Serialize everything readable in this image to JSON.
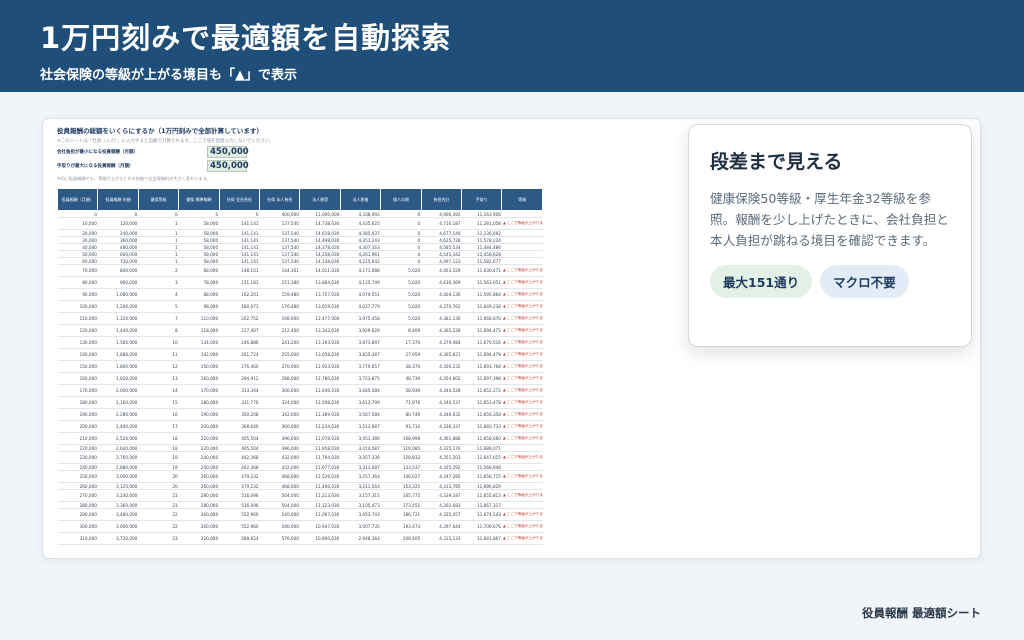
{
  "header": {
    "title": "1万円刻みで最適額を自動探索",
    "subtitle": "社会保険の等級が上がる境目も「▲」で表示"
  },
  "sheet": {
    "title": "役員報酬の総額をいくらにするか（1万円刻みで全部計算しています）",
    "note": "※このシートは「社員（入力）」に入力すると自動で計算されます。ここで値を直接入力しないでください。",
    "max_label": "会社負担が最小になる役員報酬（月額）",
    "max_value": "450,000",
    "takehome_label": "手取りが最大になる役員報酬（月額）",
    "takehome_value": "450,000",
    "note2": "※同じ役員報酬でも、等級が上がるとその前後で社会保険料が大きく変わります。",
    "columns": [
      "役員報酬（月額）",
      "役員報酬 年額",
      "健保等級",
      "健保 標準報酬",
      "社保 会社負担",
      "社保 本人負担",
      "法人税等",
      "法人税後",
      "個人の税",
      "負担合計",
      "手取り",
      "等級"
    ],
    "rows": [
      [
        "0",
        "0",
        "0",
        "0",
        "0",
        "400,000",
        "11,000,000",
        "4,338,092",
        "0",
        "4,906,392",
        "11,163,906",
        ""
      ],
      [
        "10,000",
        "120,000",
        "1",
        "58,000",
        "141,141",
        "137,540",
        "14,738,030",
        "4,435,625",
        "0",
        "4,716,187",
        "11,281,058",
        "▲ ここで等級が上がります"
      ],
      [
        "20,000",
        "240,000",
        "1",
        "58,000",
        "141,141",
        "137,540",
        "14,618,030",
        "4,385,437",
        "0",
        "4,677,149",
        "11,236,692",
        ""
      ],
      [
        "30,000",
        "360,000",
        "1",
        "58,000",
        "141,141",
        "137,540",
        "14,498,030",
        "4,351,243",
        "0",
        "4,625,728",
        "11,578,224",
        ""
      ],
      [
        "40,000",
        "480,000",
        "1",
        "58,000",
        "141,141",
        "137,540",
        "14,378,030",
        "4,307,163",
        "0",
        "4,585,534",
        "11,484,486",
        ""
      ],
      [
        "50,000",
        "600,000",
        "1",
        "58,000",
        "141,141",
        "137,540",
        "14,258,030",
        "4,261,961",
        "0",
        "4,545,342",
        "11,458,628",
        ""
      ],
      [
        "60,000",
        "720,000",
        "1",
        "58,000",
        "141,141",
        "137,540",
        "14,138,030",
        "4,215,642",
        "0",
        "4,497,123",
        "11,582,677",
        ""
      ],
      [
        "70,000",
        "840,000",
        "2",
        "68,000",
        "148,101",
        "144,361",
        "14,011,030",
        "4,171,088",
        "5,020",
        "4,463,529",
        "11,630,471",
        "▲ ここで等級が上がります"
      ],
      [
        "80,000",
        "960,000",
        "3",
        "78,000",
        "151,181",
        "151,380",
        "13,884,030",
        "4,125,749",
        "5,020",
        "4,430,369",
        "11,563,051",
        "▲ ここで等級が上がります"
      ],
      [
        "90,000",
        "1,080,000",
        "4",
        "88,000",
        "162,201",
        "159,480",
        "13,757,030",
        "4,079,551",
        "5,020",
        "4,404,136",
        "11,595,864",
        "▲ ここで等級が上がります"
      ],
      [
        "100,000",
        "1,200,000",
        "5",
        "98,000",
        "180,073",
        "176,480",
        "13,619,030",
        "4,027,779",
        "5,020",
        "4,370,762",
        "11,649,238",
        "▲ ここで等級が上がります"
      ],
      [
        "110,000",
        "1,320,000",
        "7",
        "110,000",
        "202,752",
        "198,000",
        "12,477,000",
        "3,975,458",
        "5,020",
        "4,381,130",
        "11,668,870",
        "▲ ここで等級が上がります"
      ],
      [
        "120,000",
        "1,440,000",
        "8",
        "118,000",
        "217,407",
        "212,400",
        "13,342,030",
        "3,929,628",
        "6,409",
        "4,365,528",
        "11,694,475",
        "▲ ここで等級が上がります"
      ],
      [
        "130,000",
        "1,560,000",
        "10",
        "134,000",
        "246,886",
        "241,200",
        "13,193,030",
        "3,873,897",
        "17,370",
        "4,379,484",
        "11,670,516",
        "▲ ここで等級が上がります"
      ],
      [
        "140,000",
        "1,680,000",
        "11",
        "142,000",
        "261,724",
        "255,600",
        "13,058,030",
        "3,825,387",
        "27,959",
        "4,365,621",
        "11,694,479",
        "▲ ここで等級が上がります"
      ],
      [
        "150,000",
        "1,800,000",
        "12",
        "150,000",
        "276,460",
        "270,000",
        "12,923,030",
        "3,779,657",
        "38,370",
        "4,356,232",
        "11,693,768",
        "▲ ここで等級が上がります"
      ],
      [
        "160,000",
        "1,920,000",
        "13",
        "160,000",
        "294,912",
        "288,000",
        "12,780,030",
        "3,723,875",
        "48,739",
        "4,354,602",
        "11,697,398",
        "▲ ここで等級が上がります"
      ],
      [
        "170,000",
        "2,040,000",
        "14",
        "170,000",
        "313,344",
        "306,000",
        "12,646,030",
        "3,665,584",
        "58,939",
        "4,344,528",
        "11,652,272",
        "▲ ここで等級が上がります"
      ],
      [
        "180,000",
        "2,160,000",
        "15",
        "180,000",
        "331,776",
        "324,000",
        "12,508,030",
        "3,613,799",
        "71,976",
        "4,340,537",
        "11,653,478",
        "▲ ここで等級が上がります"
      ],
      [
        "190,000",
        "2,280,000",
        "16",
        "190,000",
        "350,208",
        "342,000",
        "12,369,030",
        "3,567,584",
        "80,749",
        "4,346,632",
        "11,656,358",
        "▲ ここで等級が上がります"
      ],
      [
        "200,000",
        "2,400,000",
        "17",
        "200,000",
        "368,640",
        "360,000",
        "12,234,030",
        "3,513,987",
        "93,710",
        "4,336,337",
        "11,660,733",
        "▲ ここで等級が上がります"
      ],
      [
        "210,000",
        "2,520,000",
        "18",
        "220,000",
        "405,504",
        "396,000",
        "12,078,030",
        "3,451,386",
        "108,998",
        "4,361,888",
        "11,658,060",
        "▲ ここで等級が上がります"
      ],
      [
        "220,000",
        "2,640,000",
        "18",
        "220,000",
        "405,504",
        "396,000",
        "11,958,030",
        "3,414,087",
        "119,085",
        "4,335,176",
        "11,688,071",
        ""
      ],
      [
        "230,000",
        "2,760,000",
        "19",
        "240,000",
        "442,368",
        "432,000",
        "11,794,030",
        "3,357,336",
        "128,832",
        "4,351,203",
        "11,647,615",
        "▲ ここで等級が上がります"
      ],
      [
        "240,000",
        "2,880,000",
        "19",
        "240,000",
        "442,368",
        "432,000",
        "11,677,030",
        "3,313,087",
        "133,537",
        "4,325,292",
        "11,568,948",
        ""
      ],
      [
        "250,000",
        "3,000,000",
        "20",
        "260,000",
        "479,232",
        "468,000",
        "11,526,030",
        "3,257,364",
        "146,027",
        "4,347,285",
        "11,656,715",
        "▲ ここで等級が上がります"
      ],
      [
        "260,000",
        "3,120,000",
        "20",
        "260,000",
        "479,232",
        "468,000",
        "11,406,030",
        "3,211,564",
        "153,325",
        "4,313,785",
        "11,686,829",
        ""
      ],
      [
        "270,000",
        "3,240,000",
        "21",
        "280,000",
        "516,096",
        "504,000",
        "11,213,030",
        "3,157,315",
        "165,775",
        "4,339,187",
        "11,655,813",
        "▲ ここで等級が上がります"
      ],
      [
        "280,000",
        "3,360,000",
        "21",
        "280,000",
        "516,096",
        "504,000",
        "11,123,030",
        "3,105,473",
        "173,451",
        "4,302,683",
        "11,667,317",
        ""
      ],
      [
        "290,000",
        "3,480,000",
        "22",
        "300,000",
        "552,960",
        "540,000",
        "11,067,030",
        "3,053,743",
        "186,721",
        "4,325,457",
        "11,674,543",
        "▲ ここで等級が上がります"
      ],
      [
        "300,000",
        "3,600,000",
        "22",
        "300,000",
        "552,960",
        "540,000",
        "10,947,030",
        "3,007,735",
        "193,473",
        "4,297,644",
        "11,706,676",
        "▲ ここで等級が上がります"
      ],
      [
        "310,000",
        "3,720,000",
        "23",
        "320,000",
        "589,824",
        "576,000",
        "10,800,030",
        "2,948,364",
        "208,405",
        "4,315,133",
        "11,681,867",
        "▲ ここで等級が上がります"
      ]
    ]
  },
  "card": {
    "title": "段差まで見える",
    "body": "健康保険50等級・厚生年金32等級を参照。報酬を少し上げたときに、会社負担と本人負担が跳ねる境目を確認できます。",
    "chip_green": "最大151通り",
    "chip_blue": "マクロ不要"
  },
  "footer": {
    "label": "役員報酬 最適額シート"
  }
}
